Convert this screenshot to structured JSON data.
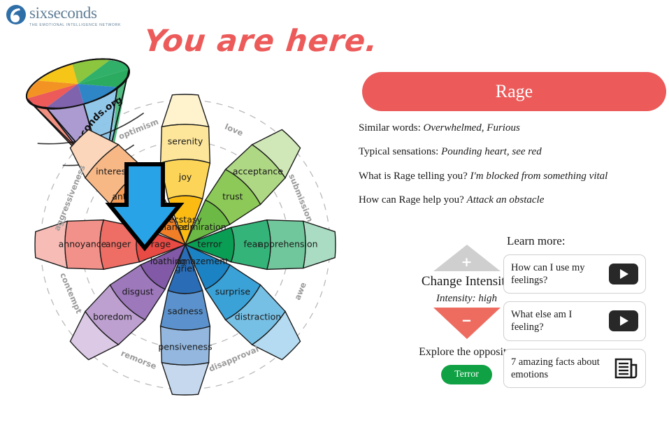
{
  "brand": {
    "name": "sixseconds",
    "tagline": "THE EMOTIONAL INTELLIGENCE NETWORK",
    "wheel_watermark": "6seconds.org"
  },
  "headline": "You are here.",
  "emotion": {
    "name": "Rage",
    "banner_color": "#ec5a5a",
    "similar_label": "Similar words:",
    "similar_value": "Overwhelmed, Furious",
    "sensations_label": "Typical sensations:",
    "sensations_value": "Pounding heart, see red",
    "telling_label": "What is Rage telling you?",
    "telling_value": "I'm blocked from something vital",
    "help_label": "How can Rage help you?",
    "help_value": "Attack an obstacle"
  },
  "intensity": {
    "increase_sign": "+",
    "decrease_sign": "‒",
    "title": "Change Intensity",
    "value": "Intensity: high",
    "increase_color": "#cfcfcf",
    "decrease_color": "#ee6b5f",
    "opposite_label": "Explore the opposite:",
    "opposite_value": "Terror",
    "opposite_color": "#0fa144"
  },
  "learn_more": {
    "title": "Learn more:",
    "items": [
      {
        "text": "How can I use my feelings?",
        "icon": "play-video-icon"
      },
      {
        "text": "What else am I feeling?",
        "icon": "play-video-icon"
      },
      {
        "text": "7 amazing facts about emotions",
        "icon": "article-document-icon"
      }
    ]
  },
  "wheel": {
    "selected": "rage",
    "pointer_color": "#29a3e8",
    "petals": [
      {
        "name": "joy",
        "angle": -90,
        "colors": [
          "#fbbb12",
          "#fcd558",
          "#fde69a",
          "#fef3cd"
        ],
        "levels": [
          "ecstasy",
          "joy",
          "serenity",
          ""
        ]
      },
      {
        "name": "trust",
        "angle": -45,
        "colors": [
          "#6cba45",
          "#8dc958",
          "#afd884",
          "#d0e8b7"
        ],
        "levels": [
          "admiration",
          "trust",
          "acceptance",
          ""
        ]
      },
      {
        "name": "fear",
        "angle": 0,
        "colors": [
          "#0a9e55",
          "#35b479",
          "#71c79c",
          "#a9dcc2"
        ],
        "levels": [
          "terror",
          "fear",
          "apprehension",
          ""
        ]
      },
      {
        "name": "surprise",
        "angle": 45,
        "colors": [
          "#1b82c4",
          "#3ba2d8",
          "#77c0e5",
          "#b4dbf1"
        ],
        "levels": [
          "amazement",
          "surprise",
          "distraction",
          ""
        ]
      },
      {
        "name": "sadness",
        "angle": 90,
        "colors": [
          "#2a6cb5",
          "#5b92cd",
          "#93b7de",
          "#c5d8ee"
        ],
        "levels": [
          "grief",
          "sadness",
          "pensiveness",
          ""
        ]
      },
      {
        "name": "disgust",
        "angle": 135,
        "colors": [
          "#8159a6",
          "#9d78bb",
          "#bda0d0",
          "#dcc9e5"
        ],
        "levels": [
          "loathing",
          "disgust",
          "boredom",
          ""
        ]
      },
      {
        "name": "anger",
        "angle": 180,
        "colors": [
          "#e84a44",
          "#ee6d64",
          "#f29189",
          "#f7bcb6"
        ],
        "levels": [
          "rage",
          "anger",
          "annoyance",
          ""
        ]
      },
      {
        "name": "anticipation",
        "angle": -135,
        "colors": [
          "#f07f28",
          "#f49b55",
          "#f8b886",
          "#fbd6ba"
        ],
        "levels": [
          "vigilance",
          "anticipation",
          "interest",
          ""
        ]
      }
    ],
    "dyads": [
      {
        "label": "optimism",
        "angle": -112
      },
      {
        "label": "love",
        "angle": -67
      },
      {
        "label": "submission",
        "angle": -22
      },
      {
        "label": "awe",
        "angle": 22
      },
      {
        "label": "disapproval",
        "angle": 67
      },
      {
        "label": "remorse",
        "angle": 112
      },
      {
        "label": "contempt",
        "angle": 157
      },
      {
        "label": "aggressiveness",
        "angle": 202
      }
    ]
  }
}
